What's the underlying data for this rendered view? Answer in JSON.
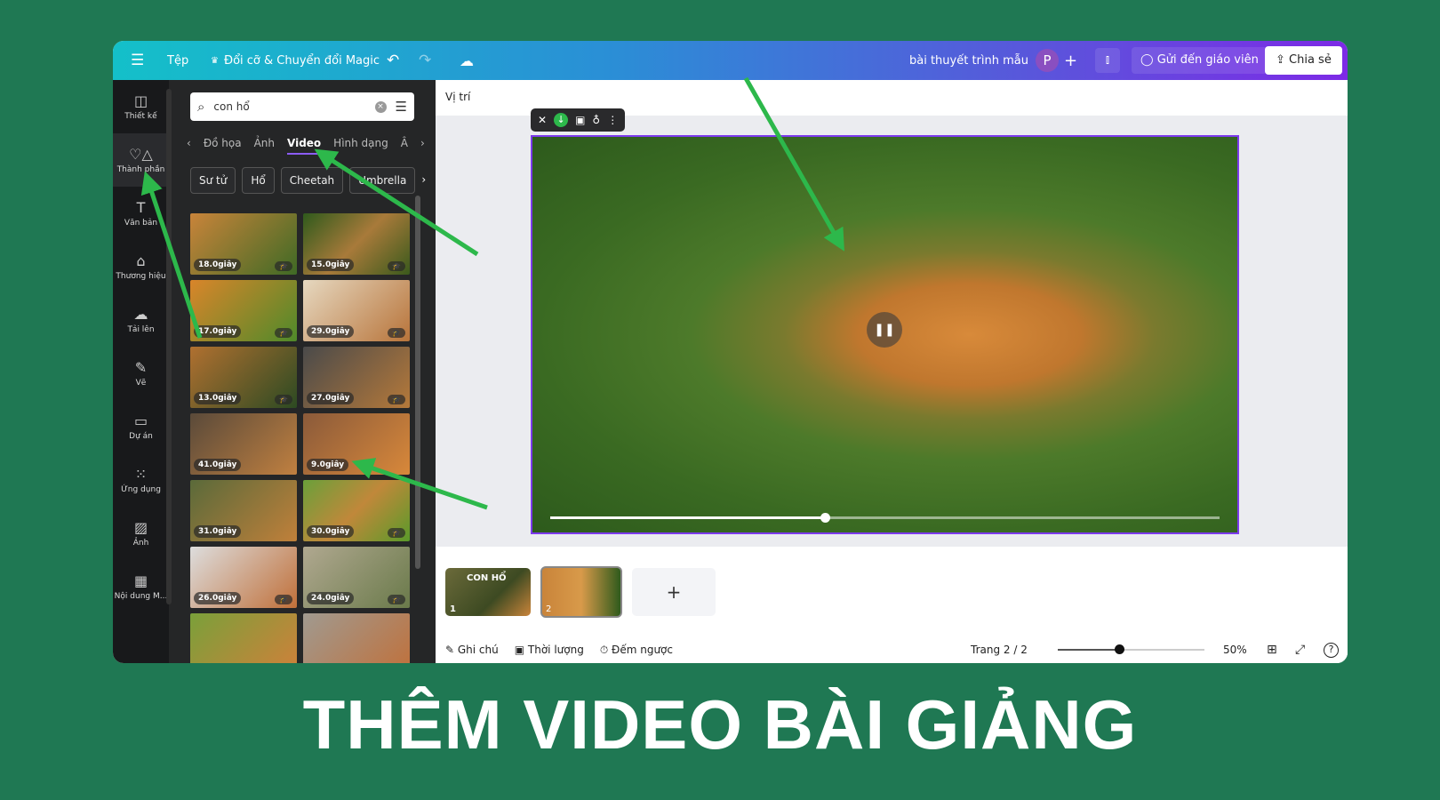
{
  "topbar": {
    "file": "Tệp",
    "magic": "Đổi cỡ & Chuyển đổi Magic",
    "doc_title": "bài thuyết trình mẫu",
    "avatar": "P",
    "send_teacher": "Gửi đến giáo viên",
    "share": "Chia sẻ"
  },
  "rail": [
    {
      "label": "Thiết kế",
      "icon": "layout-icon"
    },
    {
      "label": "Thành phần",
      "icon": "shapes-icon"
    },
    {
      "label": "Văn bản",
      "icon": "text-icon"
    },
    {
      "label": "Thương hiệu",
      "icon": "brand-icon"
    },
    {
      "label": "Tải lên",
      "icon": "upload-icon"
    },
    {
      "label": "Vẽ",
      "icon": "draw-icon"
    },
    {
      "label": "Dự án",
      "icon": "folder-icon"
    },
    {
      "label": "Ứng dụng",
      "icon": "apps-icon"
    },
    {
      "label": "Ảnh",
      "icon": "image-icon"
    },
    {
      "label": "Nội dung M...",
      "icon": "magic-media-icon"
    }
  ],
  "panel": {
    "search_value": "con hổ",
    "tabs": [
      "Đồ họa",
      "Ảnh",
      "Video",
      "Hình dạng",
      "Â"
    ],
    "active_tab": "Video",
    "chips": [
      "Sư tử",
      "Hổ",
      "Cheetah",
      "Umbrella"
    ],
    "videos": [
      "18.0giây",
      "15.0giây",
      "17.0giây",
      "29.0giây",
      "13.0giây",
      "27.0giây",
      "41.0giây",
      "9.0giây",
      "31.0giây",
      "30.0giây",
      "26.0giây",
      "24.0giây",
      "",
      ""
    ]
  },
  "canvas": {
    "position_label": "Vị trí",
    "video_progress": 0.41
  },
  "pages": {
    "thumb1_title": "CON HỔ",
    "thumb1_num": "1",
    "thumb2_num": "2",
    "add": "+"
  },
  "footer": {
    "notes": "Ghi chú",
    "duration": "Thời lượng",
    "timer": "Đếm ngược",
    "page": "Trang 2 / 2",
    "zoom": "50%",
    "zoom_level": 0.42
  },
  "caption": "THÊM VIDEO BÀI GIẢNG",
  "colors": {
    "background": "#1f7853",
    "accent": "#7c3aed",
    "arrow": "#2db84b"
  }
}
